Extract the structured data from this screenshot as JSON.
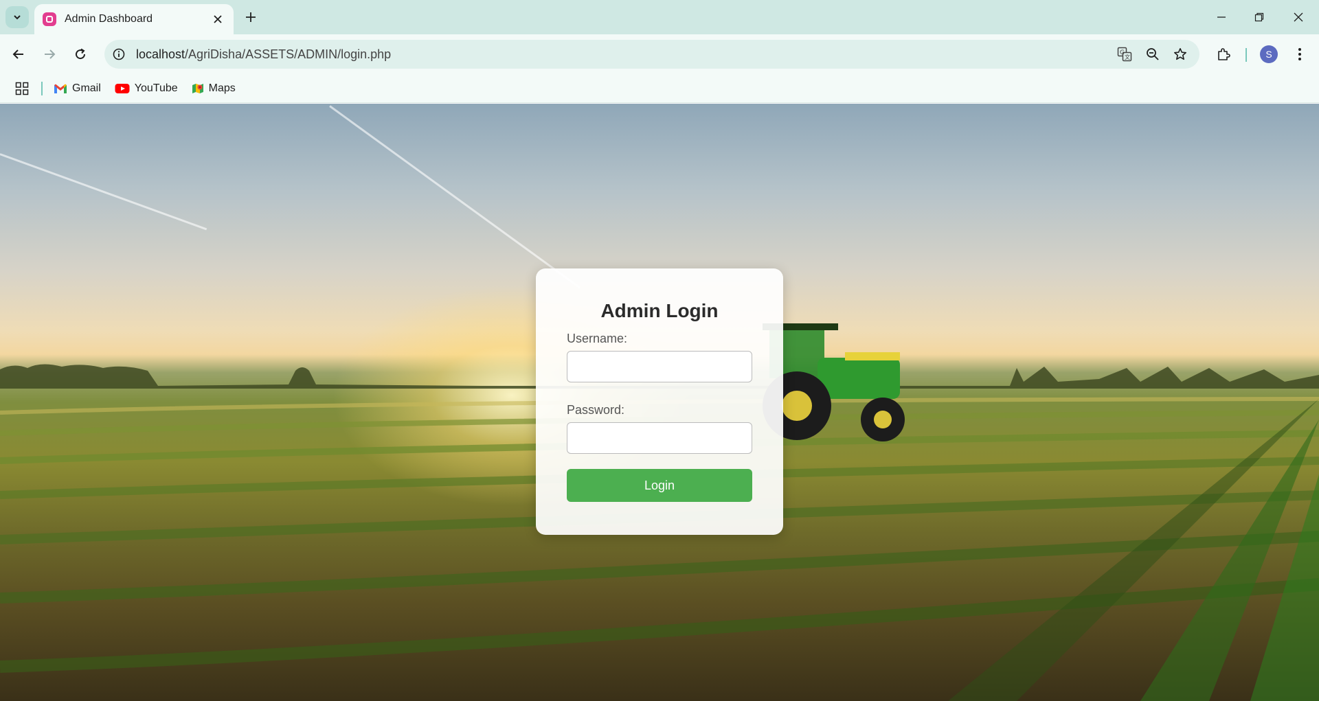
{
  "browser": {
    "tab": {
      "title": "Admin Dashboard"
    },
    "url": {
      "host": "localhost",
      "path": "/AgriDisha/ASSETS/ADMIN/login.php"
    },
    "profile_initial": "S",
    "bookmarks": [
      {
        "label": "Gmail",
        "icon": "gmail-icon"
      },
      {
        "label": "YouTube",
        "icon": "youtube-icon"
      },
      {
        "label": "Maps",
        "icon": "maps-icon"
      }
    ]
  },
  "login": {
    "title": "Admin Login",
    "username_label": "Username:",
    "username_value": "",
    "password_label": "Password:",
    "password_value": "",
    "button_label": "Login"
  },
  "colors": {
    "button": "#4caf50",
    "tab_strip": "#cfe8e3",
    "toolbar": "#f3faf8"
  }
}
